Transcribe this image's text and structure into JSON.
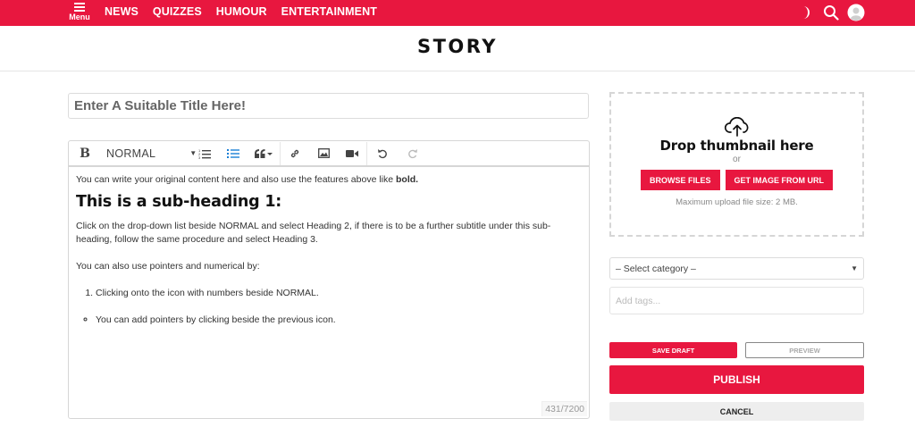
{
  "nav": {
    "menu_label": "Menu",
    "links": [
      "NEWS",
      "QUIZZES",
      "HUMOUR",
      "ENTERTAINMENT"
    ],
    "icons": [
      "theme-toggle-icon",
      "search-icon",
      "user-avatar-icon"
    ],
    "brand_color": "#e8173f"
  },
  "page": {
    "title": "STORY"
  },
  "form": {
    "title_placeholder": "Enter A Suitable Title Here!",
    "toolbar": {
      "bold_label": "B",
      "format_value": "NORMAL",
      "icons": [
        "bold-icon",
        "ordered-list-icon",
        "bullet-list-icon",
        "quote-icon",
        "link-icon",
        "image-icon",
        "video-icon",
        "undo-icon",
        "redo-icon"
      ]
    },
    "content": {
      "p1_text": "You can write your original content here and also use the features above like ",
      "p1_bold": "bold.",
      "heading": "This is a sub-heading 1:",
      "p2": "Click on the drop-down list beside NORMAL and select Heading 2, if there is to be a further subtitle under this sub-heading, follow the same procedure and select Heading 3.",
      "p3": "You can also use pointers and numerical by:",
      "ordered_item": "Clicking onto the icon with numbers beside NORMAL.",
      "bullet_item": "You can add pointers by clicking beside the previous icon."
    },
    "counter": "431/7200"
  },
  "sidebar": {
    "drop_title": "Drop thumbnail here",
    "drop_or": "or",
    "browse_label": "BROWSE FILES",
    "url_label": "GET IMAGE FROM URL",
    "max_note": "Maximum upload file size: 2 MB.",
    "category_value": "– Select category –",
    "tags_placeholder": "Add tags...",
    "save_draft": "SAVE DRAFT",
    "preview": "PREVIEW",
    "publish": "PUBLISH",
    "cancel": "CANCEL"
  }
}
